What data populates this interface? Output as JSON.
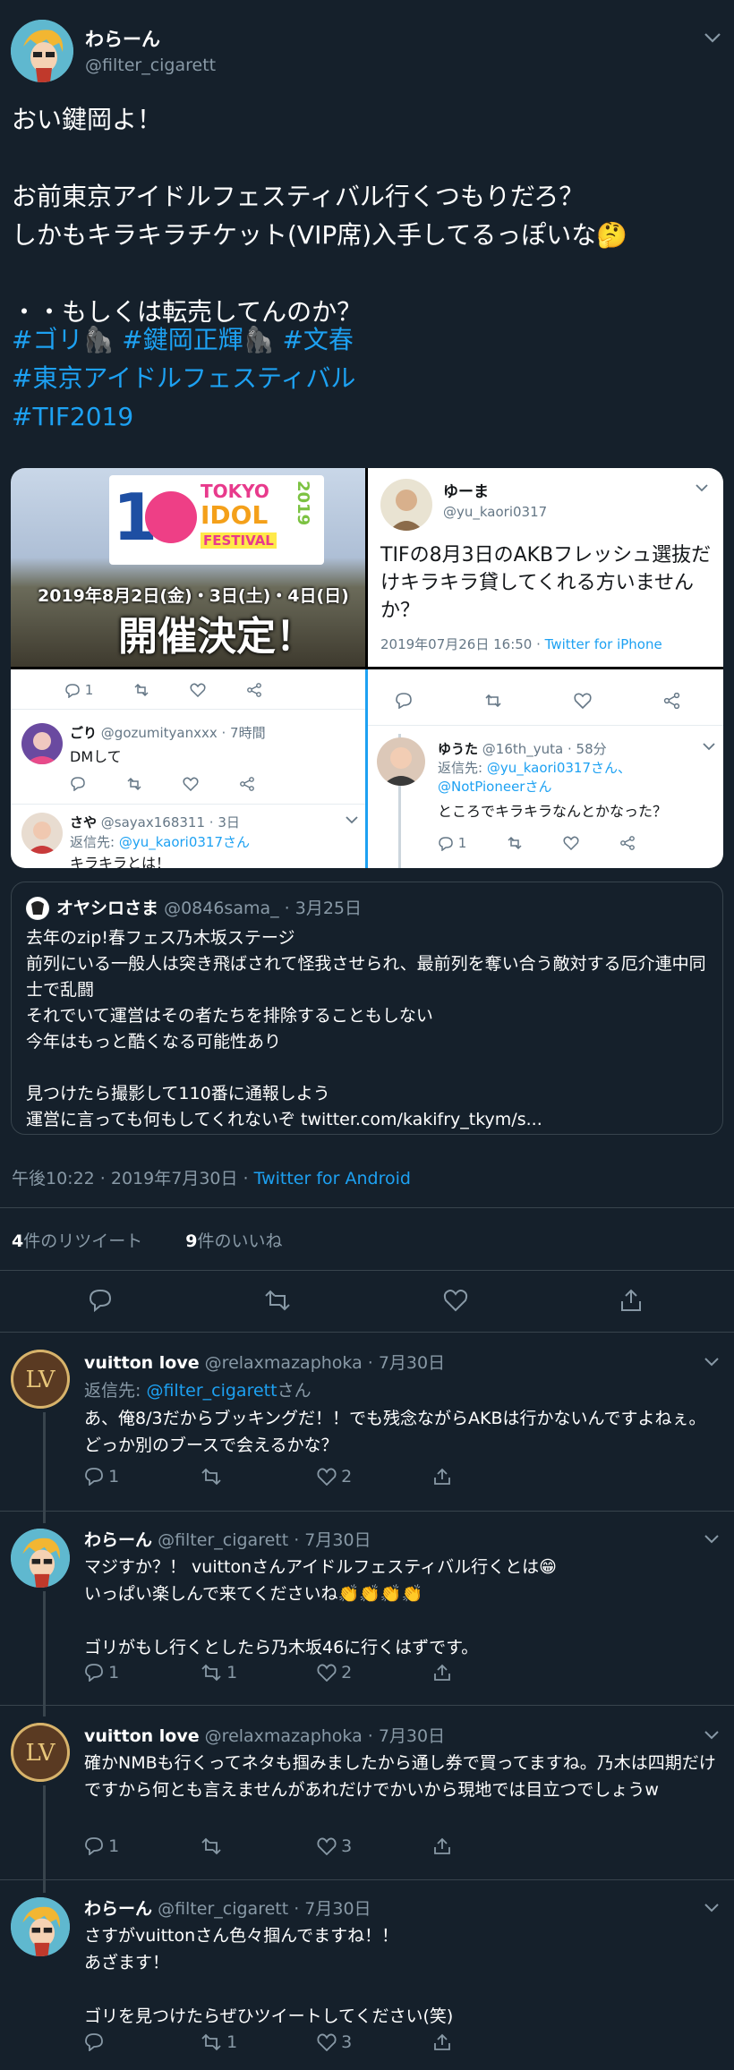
{
  "main_tweet": {
    "name": "わらーん",
    "handle": "@filter_cigarett",
    "body": "おい鍵岡よ！\n\nお前東京アイドルフェスティバル行くつもりだろ？\nしかもキラキラチケット(VIP席)入手してるっぽいな🤔\n\n・・もしくは転売してんのか？",
    "hashtags": [
      "#ゴリ🦍",
      "#鍵岡正輝🦍",
      "#文春",
      "#東京アイドルフェスティバル",
      "#TIF2019"
    ],
    "timestamp": "午後10:22 · 2019年7月30日 · ",
    "client": "Twitter for Android",
    "retweets": "4",
    "retweets_label": "件のリツイート",
    "likes": "9",
    "likes_label": "件のいいね"
  },
  "images": {
    "banner": {
      "logo_top": "TOKYO",
      "logo_mid": "IDOL",
      "logo_bot": "FESTIVAL",
      "year": "2019",
      "dates": "2019年8月2日(金)・3日(土)・4日(日)",
      "headline": "開催決定！"
    },
    "tweet_card": {
      "name": "ゆーま",
      "handle": "@yu_kaori0317",
      "body": "TIFの8月3日のAKBフレッシュ選抜だけキラキラ貸してくれる方いませんか？",
      "meta": "2019年07月26日 16:50 · ",
      "client": "Twitter for iPhone"
    },
    "reply_left1": {
      "count": "1"
    },
    "reply_left2": {
      "name": "ごり",
      "handle": "@gozumityanxxx · 7時間",
      "body": "DMして"
    },
    "reply_left3": {
      "name": "さや",
      "handle": "@sayax168311 · 3日",
      "reply_label": "返信先: ",
      "reply_to": "@yu_kaori0317さん",
      "body": "キラキラとは！"
    },
    "reply_right": {
      "name": "ゆうた",
      "handle": "@16th_yuta · 58分",
      "reply_label": "返信先: ",
      "reply_to": "@yu_kaori0317さん、@NotPioneerさん",
      "body": "ところでキラキラなんとかなった？",
      "count": "1"
    }
  },
  "quote": {
    "name": "オヤシロさま",
    "handle": "@0846sama_ · 3月25日",
    "body": "去年のzip!春フェス乃木坂ステージ\n前列にいる一般人は突き飛ばされて怪我させられ、最前列を奪い合う敵対する厄介連中同士で乱闘\nそれでいて運営はその者たちを排除することもしない\n今年はもっと酷くなる可能性あり\n\n見つけたら撮影して110番に通報しよう\n運営に言っても何もしてくれないぞ twitter.com/kakifry_tkym/s..."
  },
  "replies": [
    {
      "name": "vuitton love",
      "handle": "@relaxmazaphoka · 7月30日",
      "reply_label": "返信先: ",
      "reply_to": "@filter_cigarett",
      "reply_suffix": "さん",
      "body": "あ、俺8/3だからブッキングだ！！でも残念ながらAKBは行かないんですよねぇ。どっか別のブースで会えるかな？",
      "reply_count": "1",
      "retweet_count": "",
      "like_count": "2"
    },
    {
      "name": "わらーん",
      "handle": "@filter_cigarett · 7月30日",
      "body": "マジすか？！ vuittonさんアイドルフェスティバル行くとは😁\nいっぱい楽しんで来てくださいね👏👏👏👏\n\nゴリがもし行くとしたら乃木坂46に行くはずです。",
      "reply_count": "1",
      "retweet_count": "1",
      "like_count": "2"
    },
    {
      "name": "vuitton love",
      "handle": "@relaxmazaphoka · 7月30日",
      "body": "確かNMBも行くってネタも掴みましたから通し券で買ってますね。乃木は四期だけですから何とも言えませんがあれだけでかいから現地では目立つでしょうw",
      "reply_count": "1",
      "retweet_count": "",
      "like_count": "3"
    },
    {
      "name": "わらーん",
      "handle": "@filter_cigarett · 7月30日",
      "body": "さすがvuittonさん色々掴んでますね！！\nあざます！\n\nゴリを見つけたらぜひツイートしてください(笑)",
      "reply_count": "",
      "retweet_count": "1",
      "like_count": "3"
    }
  ],
  "colors": {
    "bg": "#15202b",
    "blue": "#1da1f2",
    "grey": "#8899a6",
    "divider": "#38444d"
  }
}
